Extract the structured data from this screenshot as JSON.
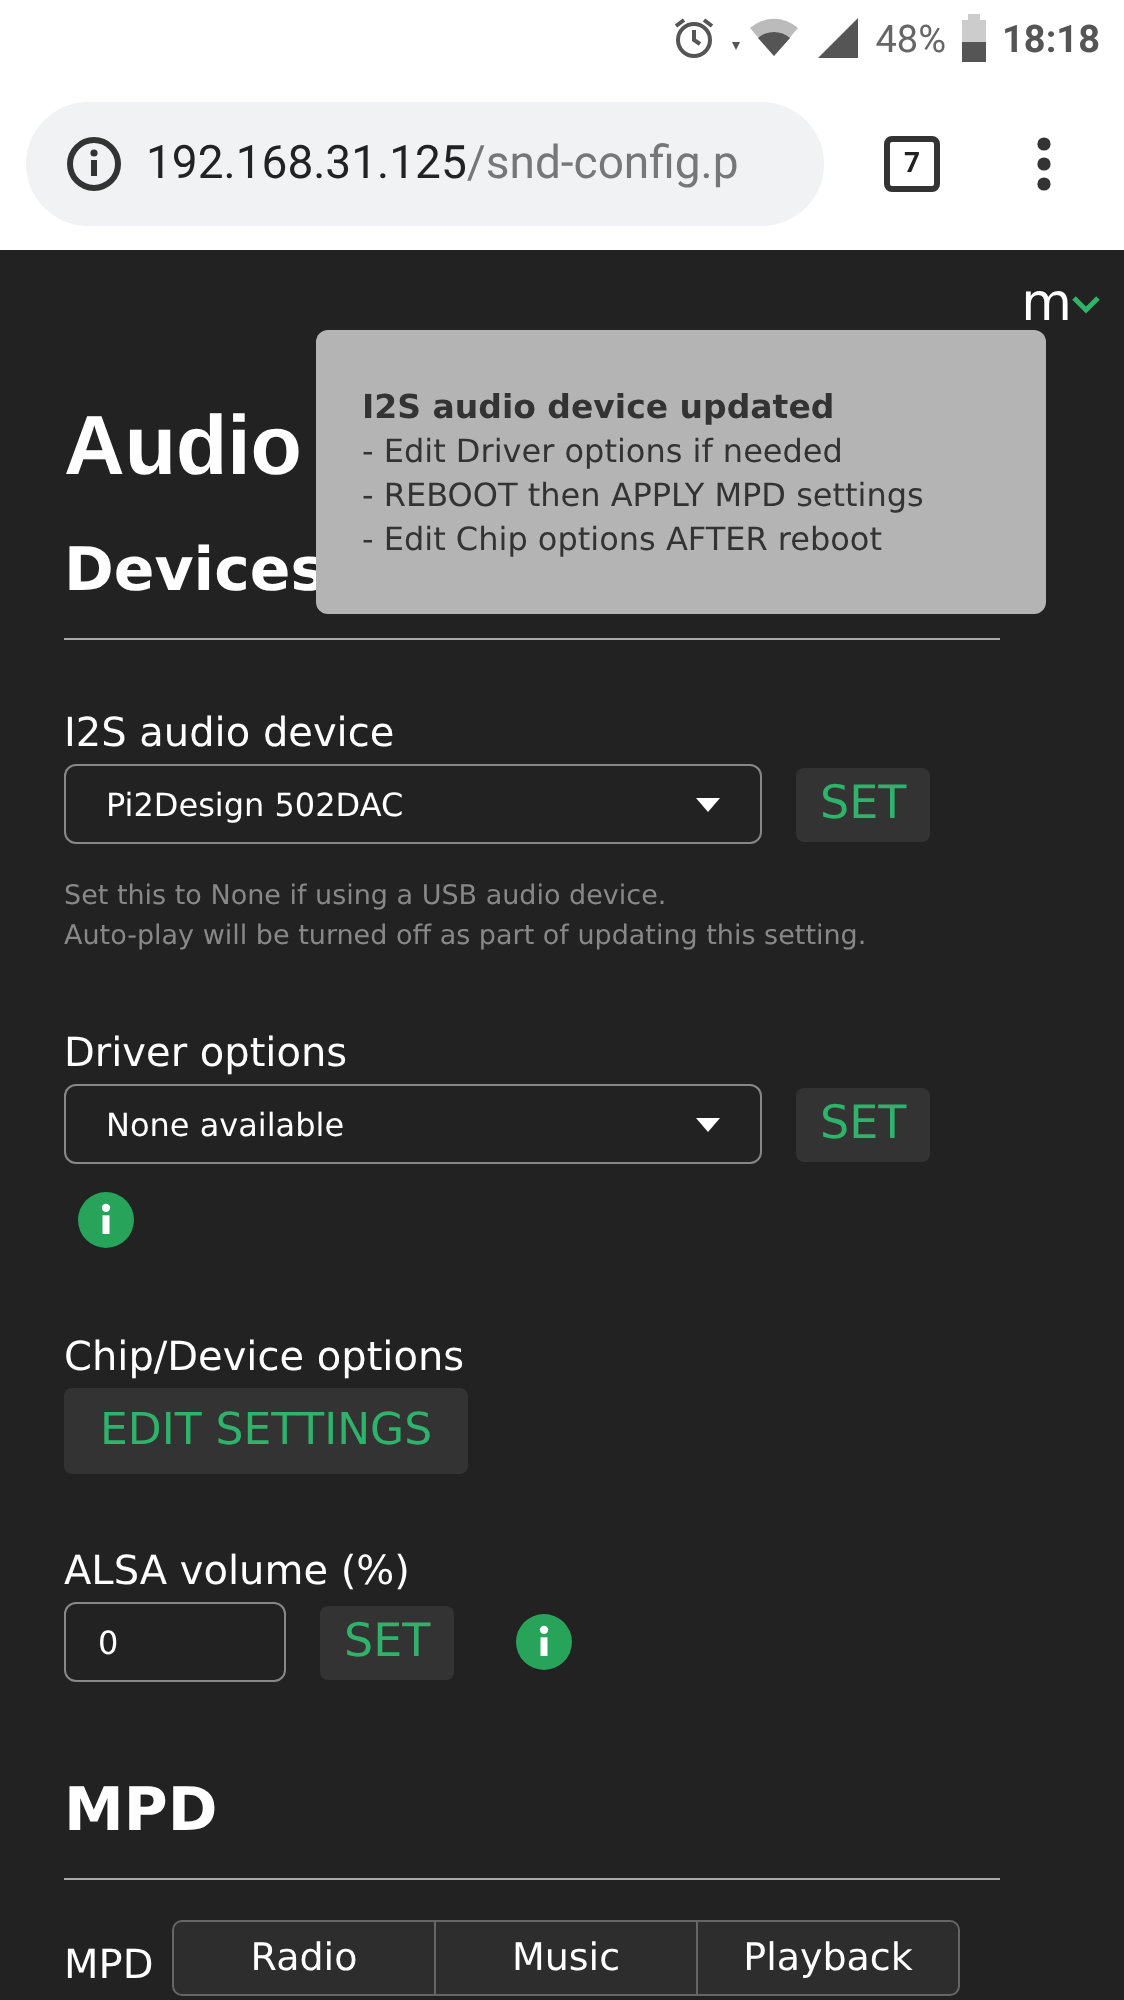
{
  "status_bar": {
    "battery": "48%",
    "time": "18:18"
  },
  "address_bar": {
    "host": "192.168.31.125",
    "path": "/snd-config.p",
    "tab_count": "7"
  },
  "header": {
    "logo": "m"
  },
  "title": "Audio",
  "toast": {
    "title": "I2S audio device updated",
    "lines": [
      "- Edit Driver options if needed",
      "- REBOOT then APPLY MPD settings",
      "- Edit Chip options AFTER reboot"
    ]
  },
  "devices": {
    "heading": "Devices",
    "fields": [
      {
        "kind": "select",
        "label": "I2S audio device",
        "value": "Pi2Design 502DAC",
        "button": "SET",
        "help": [
          "Set this to None if using a USB audio device.",
          "Auto-play will be turned off as part of updating this setting."
        ],
        "info": false
      },
      {
        "kind": "select",
        "label": "Driver options",
        "value": "None available",
        "button": "SET",
        "info": true
      },
      {
        "kind": "action",
        "label": "Chip/Device options",
        "button": "EDIT SETTINGS",
        "info": false
      },
      {
        "kind": "input",
        "label": "ALSA volume (%)",
        "value": "0",
        "button": "SET",
        "info": true
      }
    ]
  },
  "mpd": {
    "heading": "MPD",
    "label": "MPD"
  },
  "nav": [
    {
      "label": "Radio"
    },
    {
      "label": "Music"
    },
    {
      "label": "Playback"
    }
  ]
}
